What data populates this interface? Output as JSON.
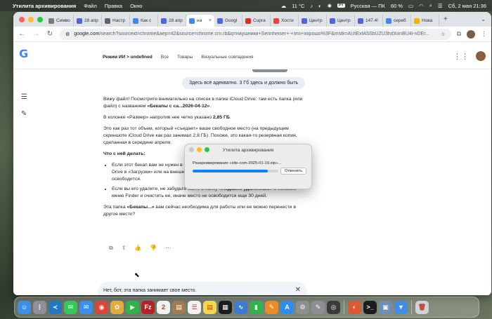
{
  "menubar": {
    "app_name": "Утилита архивирования",
    "menus": [
      "Файл",
      "Правка",
      "Окно"
    ],
    "weather": "11 °C",
    "input_badge": "PY",
    "input_source": "Русская — ПК",
    "battery": "60 %",
    "datetime": "Сб, 2 мая 21:36"
  },
  "browser": {
    "tabs": [
      {
        "label": "Симво",
        "color": "#7a7a7a"
      },
      {
        "label": "28 апр",
        "color": "#4a68d8"
      },
      {
        "label": "Настр",
        "color": "#5f6368"
      },
      {
        "label": "Как с",
        "color": "#4285f4"
      },
      {
        "label": "28 апр",
        "color": "#4a68d8"
      },
      {
        "label": "на",
        "color": "#4285f4",
        "active": true
      },
      {
        "label": "Googl",
        "color": "#4a68d8"
      },
      {
        "label": "Cupra",
        "color": "#d93025"
      },
      {
        "label": "Хости",
        "color": "#e8453c"
      },
      {
        "label": "Центр",
        "color": "#4a68d8"
      },
      {
        "label": "Центр",
        "color": "#4a68d8"
      },
      {
        "label": "147.4!",
        "color": "#4a68d8"
      },
      {
        "label": "сереб",
        "color": "#4285f4"
      },
      {
        "label": "Нова",
        "color": "#f4b400"
      }
    ],
    "new_tab": "+",
    "url_host": "google.com",
    "url_path": "/search?sourceid=chrome&aep=42&source=chrome.crn.rb&q=наушники+Sennheiser+-+это+хорошо%3F&mstk=AUtExfA5SbUZU3hdXonBU4l-nDEr..."
  },
  "page": {
    "search_tabs": [
      "Режим ИИ > undefined",
      "Все",
      "Товары",
      "Визуальные совпадения"
    ],
    "user_message": "Здесь всё адекватно. 3 Гб здесь и должно быть",
    "answer": {
      "p1_a": "Вижу файл! Посмотрите внимательно на список в папке iCloud Drive: там есть папка (или файл) с названием ",
      "p1_b": "«Бекапы с са...2026-04-12»",
      "p1_c": ".",
      "p2_a": "В колонке «Размер» напротив нее четко указано ",
      "p2_b": "2,85 ГБ",
      "p2_c": ".",
      "p3": "Это как раз тот объем, который «съедает» ваше свободное место (на предыдущем скриншоте iCloud Drive как раз занимал 2,8 ГБ). Похоже, это какая-то резервная копия, сделанная в середине апреля.",
      "heading": "Что с ней делать:",
      "li1": "Если этот бекап вам не нужен в облаке, перенесите его на внешний диск или в папку Drive в «Загрузки» или на внешний носитель. Как только он удалится из iCloud, место освободится.",
      "li2_a": "Если вы его удалите, не забудьте зайти в папку ",
      "li2_b": "«Недавно удаленные»",
      "li2_c": " в боковом меню Finder и очистить ее, иначе место не освободится еще 30 дней.",
      "p4_a": "Эта папка ",
      "p4_b": "«Бекапы...»",
      "p4_c": " вам сейчас необходима для работы или ее можно перенести в другое место?"
    },
    "composer_text": "Нет, бот, эта папка занимает свое место."
  },
  "dialog": {
    "title": "Утилита архивирования",
    "status": "Разархивирование «site-com-2025-01-19.zip»...",
    "progress": 0.88,
    "stop_label": "Отменить"
  },
  "dock": {
    "icons": [
      {
        "name": "finder",
        "color": "#3d8ee8",
        "glyph": "☺"
      },
      {
        "name": "launchpad",
        "color": "#8f8f9c",
        "glyph": "⋮"
      },
      {
        "name": "vscode",
        "color": "#1f78c4",
        "glyph": "≺"
      },
      {
        "name": "messages",
        "color": "#34c759",
        "glyph": "✉"
      },
      {
        "name": "mail",
        "color": "#3a8ff0",
        "glyph": "✉"
      },
      {
        "name": "chrome",
        "color": "#db4437",
        "glyph": "◉"
      },
      {
        "name": "photos",
        "color": "#e7a93a",
        "glyph": "✿"
      },
      {
        "name": "facetime",
        "color": "#2fb44a",
        "glyph": "▶"
      },
      {
        "name": "filezilla",
        "color": "#bf1e1e",
        "glyph": "Fz"
      },
      {
        "name": "calendar",
        "color": "#f2f2f2",
        "glyph": "2"
      },
      {
        "name": "notes-brown",
        "color": "#a37c4e",
        "glyph": "▤"
      },
      {
        "name": "reminders",
        "color": "#f2f2f2",
        "glyph": "☰"
      },
      {
        "name": "notes",
        "color": "#f5d54a",
        "glyph": "▤"
      },
      {
        "name": "stocks",
        "color": "#1c1c1e",
        "glyph": "▦"
      },
      {
        "name": "freeform",
        "color": "#3b7bd4",
        "glyph": "∿"
      },
      {
        "name": "numbers",
        "color": "#2fb44a",
        "glyph": "▮"
      },
      {
        "name": "pages",
        "color": "#f08a24",
        "glyph": "✎"
      },
      {
        "name": "app-store",
        "color": "#2a8cf5",
        "glyph": "A"
      },
      {
        "name": "system-settings",
        "color": "#8e8e93",
        "glyph": "⚙"
      },
      {
        "name": "xcode-tool",
        "color": "#8d8d93",
        "glyph": "✎"
      },
      {
        "name": "camera-app",
        "color": "#3a3a3c",
        "glyph": "◎"
      },
      {
        "name": "duckduckgo",
        "color": "#de5833",
        "glyph": "◐"
      },
      {
        "name": "terminal",
        "color": "#1c1c1e",
        "glyph": ">_"
      },
      {
        "name": "preview",
        "color": "#6e8fb5",
        "glyph": "▣"
      },
      {
        "name": "downloads",
        "color": "#3d8ee8",
        "glyph": "▼"
      },
      {
        "name": "trash",
        "color": "#cfd2d6",
        "glyph": "🗑"
      }
    ]
  }
}
